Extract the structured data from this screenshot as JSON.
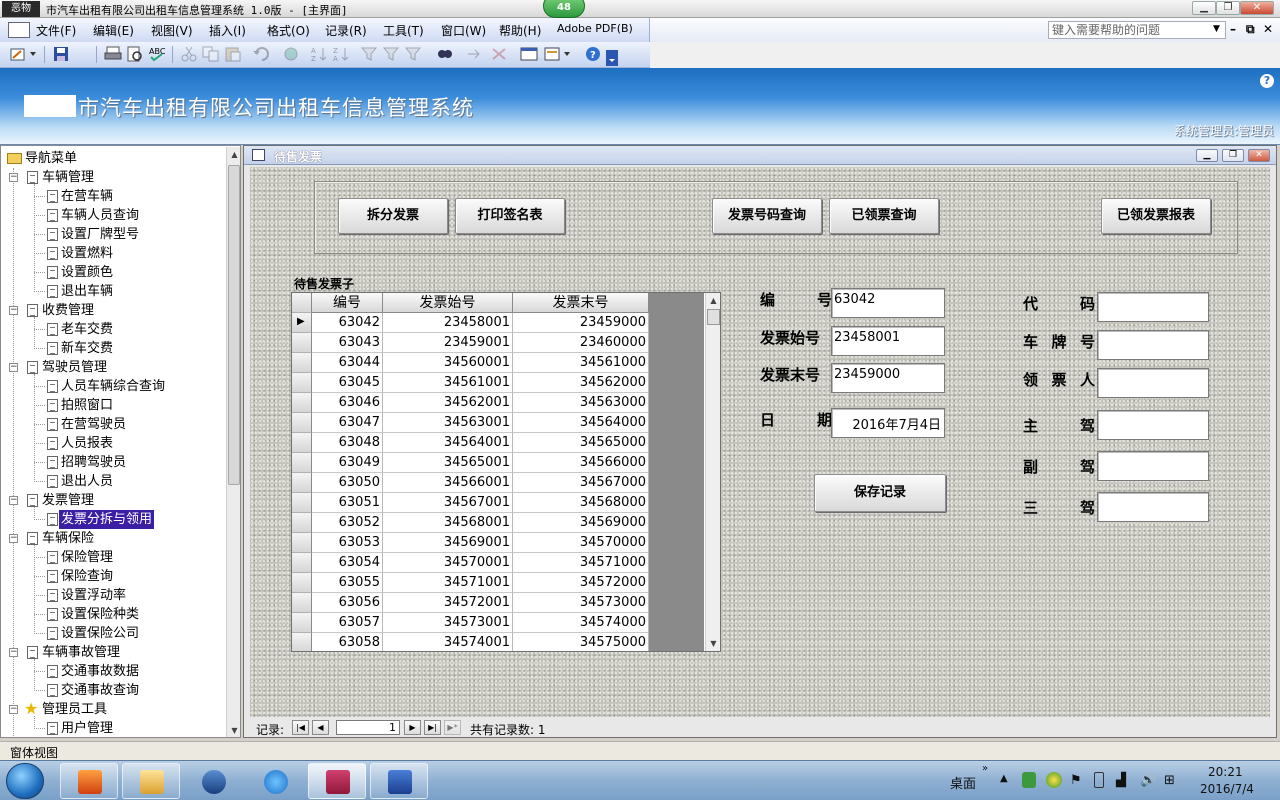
{
  "window": {
    "app_icon_text": "恶物",
    "title": "市汽车出租有限公司出租车信息管理系统 1.0版 - [主界面]",
    "cpu_badge": "48"
  },
  "menu": {
    "items": [
      "文件(F)",
      "编辑(E)",
      "视图(V)",
      "插入(I)",
      "格式(O)",
      "记录(R)",
      "工具(T)",
      "窗口(W)",
      "帮助(H)",
      "Adobe PDF(B)"
    ],
    "help_placeholder": "键入需要帮助的问题"
  },
  "banner": {
    "title": "市汽车出租有限公司出租车信息管理系统",
    "user": "系统管理员:管理员",
    "help_glyph": "?"
  },
  "nav": {
    "root": "导航菜单",
    "groups": [
      {
        "label": "车辆管理",
        "items": [
          "在营车辆",
          "车辆人员查询",
          "设置厂牌型号",
          "设置燃料",
          "设置颜色",
          "退出车辆"
        ]
      },
      {
        "label": "收费管理",
        "items": [
          "老车交费",
          "新车交费"
        ]
      },
      {
        "label": "驾驶员管理",
        "items": [
          "人员车辆综合查询",
          "拍照窗口",
          "在营驾驶员",
          "人员报表",
          "招聘驾驶员",
          "退出人员"
        ]
      },
      {
        "label": "发票管理",
        "items": [
          "发票分拆与领用"
        ]
      },
      {
        "label": "车辆保险",
        "items": [
          "保险管理",
          "保险查询",
          "设置浮动率",
          "设置保险种类",
          "设置保险公司"
        ]
      },
      {
        "label": "车辆事故管理",
        "items": [
          "交通事故数据",
          "交通事故查询"
        ]
      },
      {
        "label": "管理员工具",
        "items": [
          "用户管理"
        ]
      }
    ],
    "selected": "发票分拆与领用"
  },
  "form": {
    "title": "待售发票",
    "buttons": {
      "split": "拆分发票",
      "print_sign": "打印签名表",
      "number_query": "发票号码查询",
      "issued_query": "已领票查询",
      "issued_report": "已领发票报表",
      "save": "保存记录"
    },
    "subform": {
      "label": "待售发票子",
      "columns": [
        "编号",
        "发票始号",
        "发票末号"
      ],
      "rows": [
        [
          "63042",
          "23458001",
          "23459000"
        ],
        [
          "63043",
          "23459001",
          "23460000"
        ],
        [
          "63044",
          "34560001",
          "34561000"
        ],
        [
          "63045",
          "34561001",
          "34562000"
        ],
        [
          "63046",
          "34562001",
          "34563000"
        ],
        [
          "63047",
          "34563001",
          "34564000"
        ],
        [
          "63048",
          "34564001",
          "34565000"
        ],
        [
          "63049",
          "34565001",
          "34566000"
        ],
        [
          "63050",
          "34566001",
          "34567000"
        ],
        [
          "63051",
          "34567001",
          "34568000"
        ],
        [
          "63052",
          "34568001",
          "34569000"
        ],
        [
          "63053",
          "34569001",
          "34570000"
        ],
        [
          "63054",
          "34570001",
          "34571000"
        ],
        [
          "63055",
          "34571001",
          "34572000"
        ],
        [
          "63056",
          "34572001",
          "34573000"
        ],
        [
          "63057",
          "34573001",
          "34574000"
        ],
        [
          "63058",
          "34574001",
          "34575000"
        ]
      ],
      "current_row_marker": "▶"
    },
    "fields": {
      "number_label": "编 号",
      "number_value": "63042",
      "start_label": "发票始号",
      "start_value": "23458001",
      "end_label": "发票末号",
      "end_value": "23459000",
      "date_label": "日 期",
      "date_value": "2016年7月4日",
      "code_label": "代 码",
      "plate_label": "车 牌 号",
      "receiver_label": "领 票 人",
      "driver1_label": "主 驾",
      "driver2_label": "副 驾",
      "driver3_label": "三 驾"
    },
    "record_nav": {
      "label": "记录:",
      "current": "1",
      "total_text": "共有记录数: 1"
    }
  },
  "statusbar": {
    "text": "窗体视图"
  },
  "taskbar": {
    "desktop_label": "桌面",
    "time": "20:21",
    "date": "2016/7/4"
  }
}
